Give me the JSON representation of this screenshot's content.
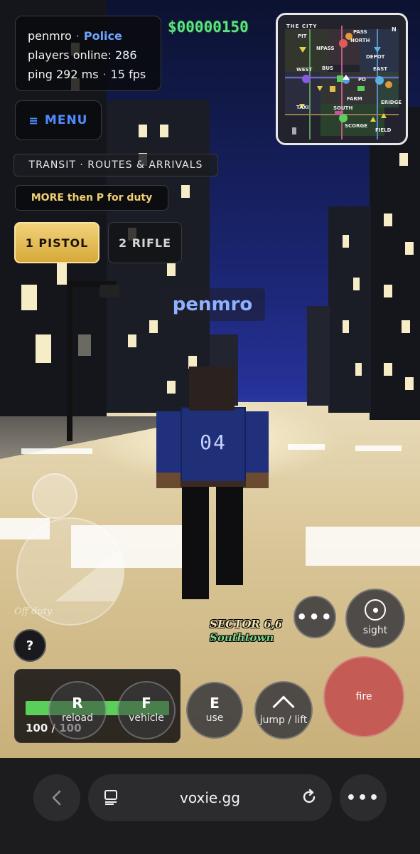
{
  "player": {
    "name": "penmro",
    "role": "Police",
    "players_online_label": "players online: 286",
    "ping_label": "ping 292 ms",
    "fps_label": "15 fps",
    "separator": "·"
  },
  "money": "$00000150",
  "minimap": {
    "title": "THE CITY",
    "north": "N",
    "labels": [
      "PIT",
      "PASS",
      "NORTH",
      "NPASS",
      "DEPOT",
      "WEST",
      "BUS",
      "PD",
      "EAST",
      "FARM",
      "ERIDGE",
      "TAXI",
      "SOUTH",
      "SCORGE",
      "FIELD"
    ]
  },
  "menu": {
    "label": "MENU"
  },
  "transit": {
    "label": "TRANSIT · ROUTES & ARRIVALS"
  },
  "hint": {
    "label": "MORE then P for duty"
  },
  "weapons": [
    {
      "label": "1 PISTOL",
      "selected": true
    },
    {
      "label": "2 RIFLE",
      "selected": false
    }
  ],
  "nametag": "penmro",
  "jersey_number": "04",
  "joystick": {
    "status": "Off duty."
  },
  "help": {
    "label": "?"
  },
  "sector": {
    "line1": "SECTOR 6,6",
    "line2": "Southtown"
  },
  "health": {
    "text": "100 / 100",
    "fraction": 1.0,
    "color": "#5ad05a"
  },
  "buttons": {
    "more": "•••",
    "sight": "sight",
    "reload_key": "R",
    "reload": "reload",
    "vehicle_key": "F",
    "vehicle": "vehicle",
    "use_key": "E",
    "use": "use",
    "jump": "jump / lift",
    "fire": "fire"
  },
  "browser": {
    "url": "voxie.gg",
    "more": "•••"
  },
  "colors": {
    "police_blue": "#6fa3ff",
    "money_green": "#5fe08a",
    "fire_red": "#c45c55",
    "weapon_gold": "#f3d27b"
  }
}
